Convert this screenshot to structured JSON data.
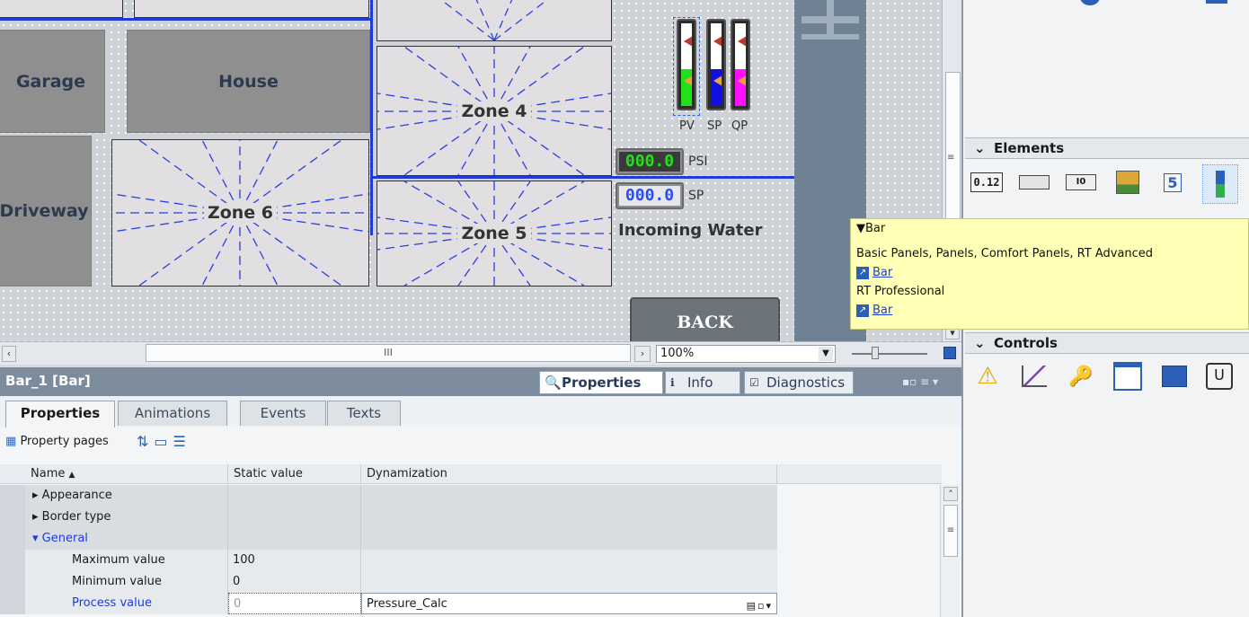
{
  "canvas": {
    "rooms": {
      "garage": "Garage",
      "house": "House",
      "driveway": "Driveway"
    },
    "zones": {
      "zone4": "Zone 4",
      "zone5": "Zone 5",
      "zone6": "Zone 6"
    },
    "bars": [
      {
        "label": "PV",
        "fill_percent": 45,
        "fill_color": "#22e01a"
      },
      {
        "label": "SP",
        "fill_percent": 45,
        "fill_color": "#1010e0"
      },
      {
        "label": "QP",
        "fill_percent": 45,
        "fill_color": "#ff10ff"
      }
    ],
    "psi_display": "000.0",
    "psi_unit": "PSI",
    "sp_display": "000.0",
    "sp_unit": "SP",
    "incoming_water": "Incoming Water",
    "back_button": "BACK",
    "zoom": "100%",
    "scroll_mark": "III"
  },
  "properties_panel": {
    "object_title": "Bar_1 [Bar]",
    "tabs": {
      "properties": "Properties",
      "info": "Info",
      "diagnostics": "Diagnostics"
    },
    "subtabs": [
      "Properties",
      "Animations",
      "Events",
      "Texts"
    ],
    "property_pages": "Property pages",
    "columns": {
      "name": "Name",
      "static": "Static value",
      "dynamization": "Dynamization"
    },
    "rows": [
      {
        "name": "Appearance",
        "static": "",
        "dyn": ""
      },
      {
        "name": "Border type",
        "static": "",
        "dyn": ""
      },
      {
        "name": "General",
        "static": "",
        "dyn": ""
      },
      {
        "name": "Maximum value",
        "static": "100",
        "dyn": ""
      },
      {
        "name": "Minimum value",
        "static": "0",
        "dyn": ""
      },
      {
        "name": "Process value",
        "static": "0",
        "dyn": "Pressure_Calc"
      }
    ]
  },
  "right_panel": {
    "elements_header": "Elements",
    "controls_header": "Controls",
    "io_icon_text": "0.12",
    "io_field_icon_text": "I0",
    "clock_icon_text": "5"
  },
  "tooltip": {
    "title": "Bar",
    "line1": "Basic Panels, Panels, Comfort Panels, RT Advanced",
    "link1": "Bar",
    "line2": "RT Professional",
    "link2": "Bar"
  },
  "colors": {
    "pipe": "#1f3bd6",
    "accent_green": "#22e01a",
    "accent_blue": "#1010e0"
  }
}
